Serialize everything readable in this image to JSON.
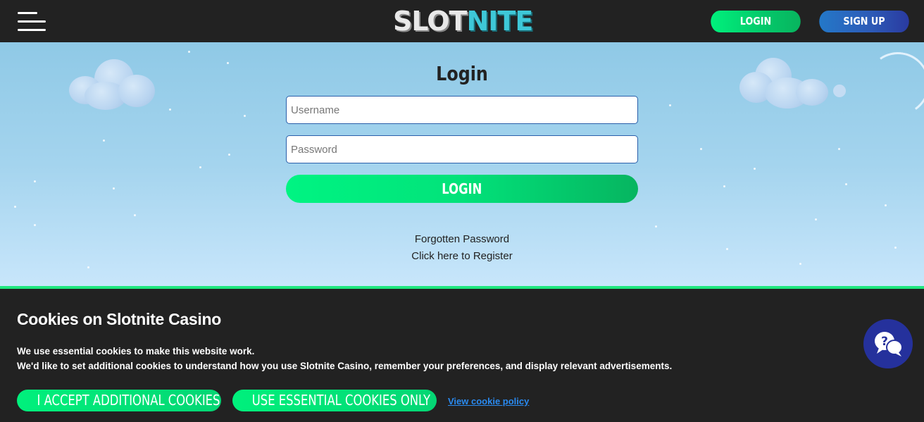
{
  "header": {
    "logo_part1": "SLOT",
    "logo_part2": "NITE",
    "login_label": "LOGIN",
    "signup_label": "SIGN UP"
  },
  "login_form": {
    "title": "Login",
    "username_placeholder": "Username",
    "password_placeholder": "Password",
    "submit_label": "LOGIN",
    "forgot_label": "Forgotten Password",
    "register_label": "Click here to Register"
  },
  "cookie_banner": {
    "title": "Cookies on Slotnite Casino",
    "line1": "We use essential cookies to make this website work.",
    "line2": "We'd like to set additional cookies to understand how you use Slotnite Casino, remember your preferences, and display relevant advertisements.",
    "accept_label": "I ACCEPT ADDITIONAL COOKIES",
    "essential_label": "USE ESSENTIAL COOKIES ONLY",
    "policy_label": "View cookie policy"
  },
  "colors": {
    "accent_green": "#00f07c",
    "accent_blue": "#2a3aa0",
    "header_bg": "#222222",
    "sky": "#a4d4ee"
  },
  "icons": {
    "menu": "hamburger-icon",
    "chat": "help-chat-icon"
  }
}
